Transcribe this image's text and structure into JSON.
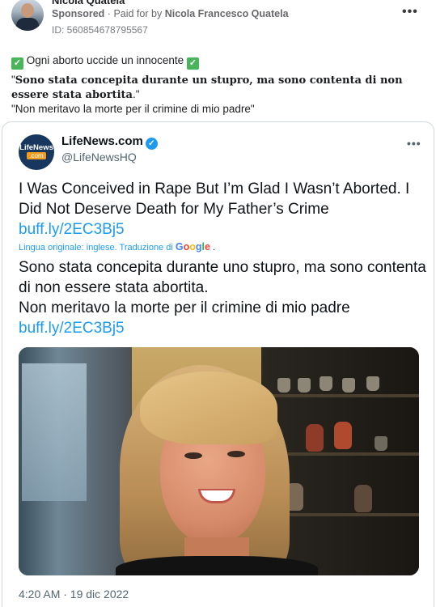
{
  "ad": {
    "poster_name": "Nicola Quatela",
    "sponsored": "Sponsored",
    "separator": "·",
    "paid_for_by": "Paid for by",
    "payer": "Nicola Francesco Quatela",
    "ad_id": "ID: 560854678795567",
    "more_label": "•••"
  },
  "post": {
    "line1": "Ogni aborto uccide un innocente",
    "line2_quote_open": "\"",
    "line2_bold": "Sono stata concepita durante un stupro, ma sono contenta di non essere stata abortita",
    "line2_end": ".\"",
    "line3": "\"Non meritavo la morte per il crimine di mio padre\""
  },
  "tweet": {
    "avatar_line1": "LifeNews",
    "avatar_line2": ".com",
    "name": "LifeNews.com",
    "verified": "✓",
    "handle": "@LifeNewsHQ",
    "more_label": "•••",
    "original_text": "I Was Conceived in Rape But I’m Glad I Wasn’t Aborted. I Did Not Deserve Death for My Father’s Crime ",
    "original_link": "buff.ly/2EC3Bj5",
    "lang_prefix": "Lingua originale: inglese. Traduzione di ",
    "google": [
      "G",
      "o",
      "o",
      "g",
      "l",
      "e"
    ],
    "lang_suffix": " .",
    "translated_line1": "Sono stata concepita durante uno stupro, ma sono contenta di non essere stata abortita.",
    "translated_line2": "Non meritavo la morte per il crimine di mio padre ",
    "translated_link": "buff.ly/2EC3Bj5",
    "timestamp": "4:20 AM · 19 dic 2022"
  },
  "colors": {
    "link": "#1d9bf0",
    "check_green": "#49b55b",
    "meta_gray": "#65676b"
  }
}
